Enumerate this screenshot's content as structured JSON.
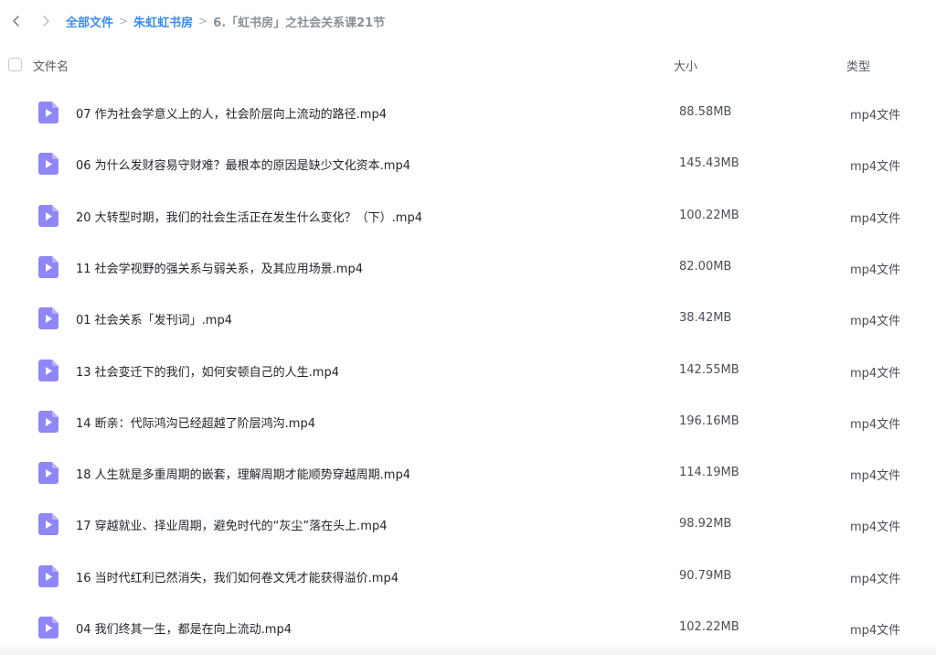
{
  "colors": {
    "accent": "#3b8cf0",
    "file_icon": "#8f87f5"
  },
  "breadcrumb": {
    "items": [
      {
        "label": "全部文件"
      },
      {
        "label": "朱虹虹书房"
      }
    ],
    "current": "6.「虹书房」之社会关系课21节",
    "separator": ">"
  },
  "header": {
    "name": "文件名",
    "size": "大小",
    "type": "类型"
  },
  "files": [
    {
      "name": "07 作为社会学意义上的人，社会阶层向上流动的路径.mp4",
      "size": "88.58MB",
      "type": "mp4文件"
    },
    {
      "name": "06 为什么发财容易守财难？最根本的原因是缺少文化资本.mp4",
      "size": "145.43MB",
      "type": "mp4文件"
    },
    {
      "name": "20 大转型时期，我们的社会生活正在发生什么变化？（下）.mp4",
      "size": "100.22MB",
      "type": "mp4文件"
    },
    {
      "name": "11 社会学视野的强关系与弱关系，及其应用场景.mp4",
      "size": "82.00MB",
      "type": "mp4文件"
    },
    {
      "name": "01 社会关系「发刊词」.mp4",
      "size": "38.42MB",
      "type": "mp4文件"
    },
    {
      "name": "13 社会变迁下的我们，如何安顿自己的人生.mp4",
      "size": "142.55MB",
      "type": "mp4文件"
    },
    {
      "name": "14 断亲：代际鸿沟已经超越了阶层鸿沟.mp4",
      "size": "196.16MB",
      "type": "mp4文件"
    },
    {
      "name": "18 人生就是多重周期的嵌套，理解周期才能顺势穿越周期.mp4",
      "size": "114.19MB",
      "type": "mp4文件"
    },
    {
      "name": "17 穿越就业、择业周期，避免时代的“灰尘”落在头上.mp4",
      "size": "98.92MB",
      "type": "mp4文件"
    },
    {
      "name": "16 当时代红利已然消失，我们如何卷文凭才能获得溢价.mp4",
      "size": "90.79MB",
      "type": "mp4文件"
    },
    {
      "name": "04 我们终其一生，都是在向上流动.mp4",
      "size": "102.22MB",
      "type": "mp4文件"
    }
  ]
}
